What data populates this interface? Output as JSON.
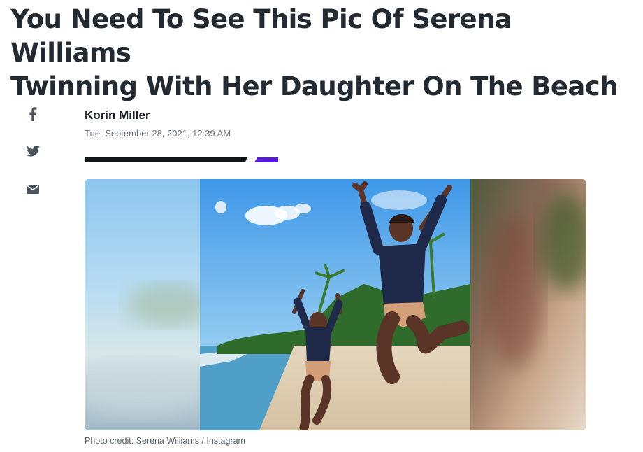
{
  "article": {
    "headline_line1": "You Need To See This Pic Of Serena Williams",
    "headline_line2": "Twinning With Her Daughter On The Beach",
    "author": "Korin Miller",
    "published": "Tue, September 28, 2021, 12:39 AM",
    "photo_caption": "Photo credit: Serena Williams / Instagram"
  },
  "share": {
    "items": [
      {
        "icon": "facebook-icon"
      },
      {
        "icon": "twitter-icon"
      },
      {
        "icon": "email-icon"
      }
    ]
  },
  "colors": {
    "accent_purple": "#5b1ad6",
    "rule_black": "#101518",
    "headline": "#232a31",
    "meta_gray": "#6e7780",
    "icon_gray": "#4b535b"
  }
}
